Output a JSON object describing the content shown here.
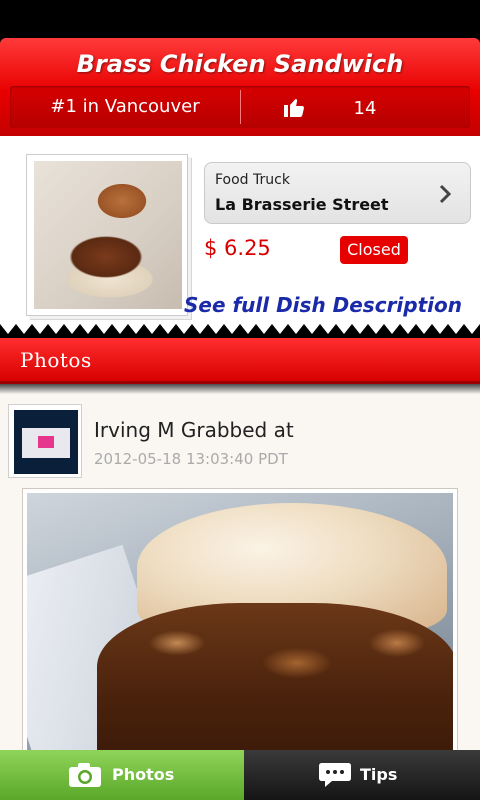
{
  "header": {
    "title": "Brass Chicken Sandwich",
    "rank": "#1 in Vancouver",
    "likes": "14"
  },
  "dish": {
    "vendor_type": "Food Truck",
    "vendor_name": "La Brasserie Street",
    "price": "$ 6.25",
    "status": "Closed",
    "description_link": "See full Dish Description"
  },
  "photos_section": {
    "title": "Photos"
  },
  "post": {
    "author_line": "Irving M Grabbed at",
    "timestamp": "2012-05-18 13:03:40 PDT"
  },
  "tabs": [
    {
      "label": "Photos",
      "icon": "camera-icon",
      "active": true
    },
    {
      "label": "Tips",
      "icon": "speech-bubble-icon",
      "active": false
    }
  ],
  "colors": {
    "accent_red": "#e80000",
    "link_blue": "#1a2aa8",
    "tab_active_green": "#6cbf35"
  }
}
